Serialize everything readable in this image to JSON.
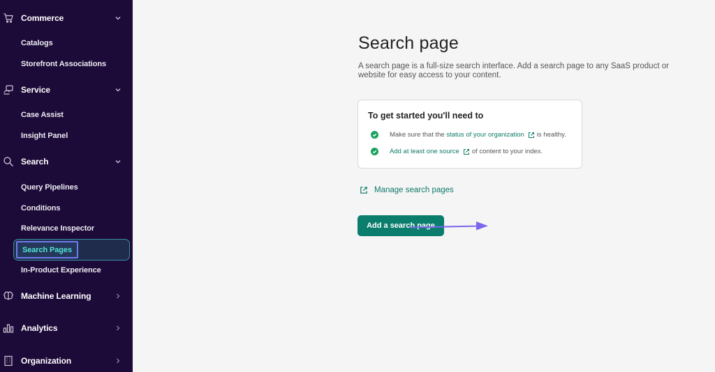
{
  "sidebar": {
    "sections": [
      {
        "label": "Commerce",
        "icon": "cart-icon",
        "expanded": true,
        "items": [
          "Catalogs",
          "Storefront Associations"
        ]
      },
      {
        "label": "Service",
        "icon": "service-icon",
        "expanded": true,
        "items": [
          "Case Assist",
          "Insight Panel"
        ]
      },
      {
        "label": "Search",
        "icon": "search-icon",
        "expanded": true,
        "items": [
          "Query Pipelines",
          "Conditions",
          "Relevance Inspector",
          "Search Pages",
          "In-Product Experience"
        ]
      },
      {
        "label": "Machine Learning",
        "icon": "brain-icon",
        "expanded": false
      },
      {
        "label": "Analytics",
        "icon": "bar-chart-icon",
        "expanded": false
      },
      {
        "label": "Organization",
        "icon": "building-icon",
        "expanded": false
      }
    ],
    "active_item": "Search Pages"
  },
  "main": {
    "title": "Search page",
    "description": "A search page is a full-size search interface. Add a search page to any SaaS product or website for easy access to your content.",
    "card": {
      "title": "To get started you'll need to",
      "req1": {
        "before": "Make sure that the",
        "link": "status of your organization",
        "after": "is healthy."
      },
      "req2": {
        "link": "Add at least one source",
        "after": "of content to your index."
      }
    },
    "manage_link": "Manage search pages",
    "add_button": "Add a search page"
  },
  "colors": {
    "sidebar_bg": "#1c0a38",
    "accent": "#0b7d6d",
    "active_text": "#4fe3d6",
    "highlight": "#6e7cf0",
    "check": "#17a35e"
  }
}
